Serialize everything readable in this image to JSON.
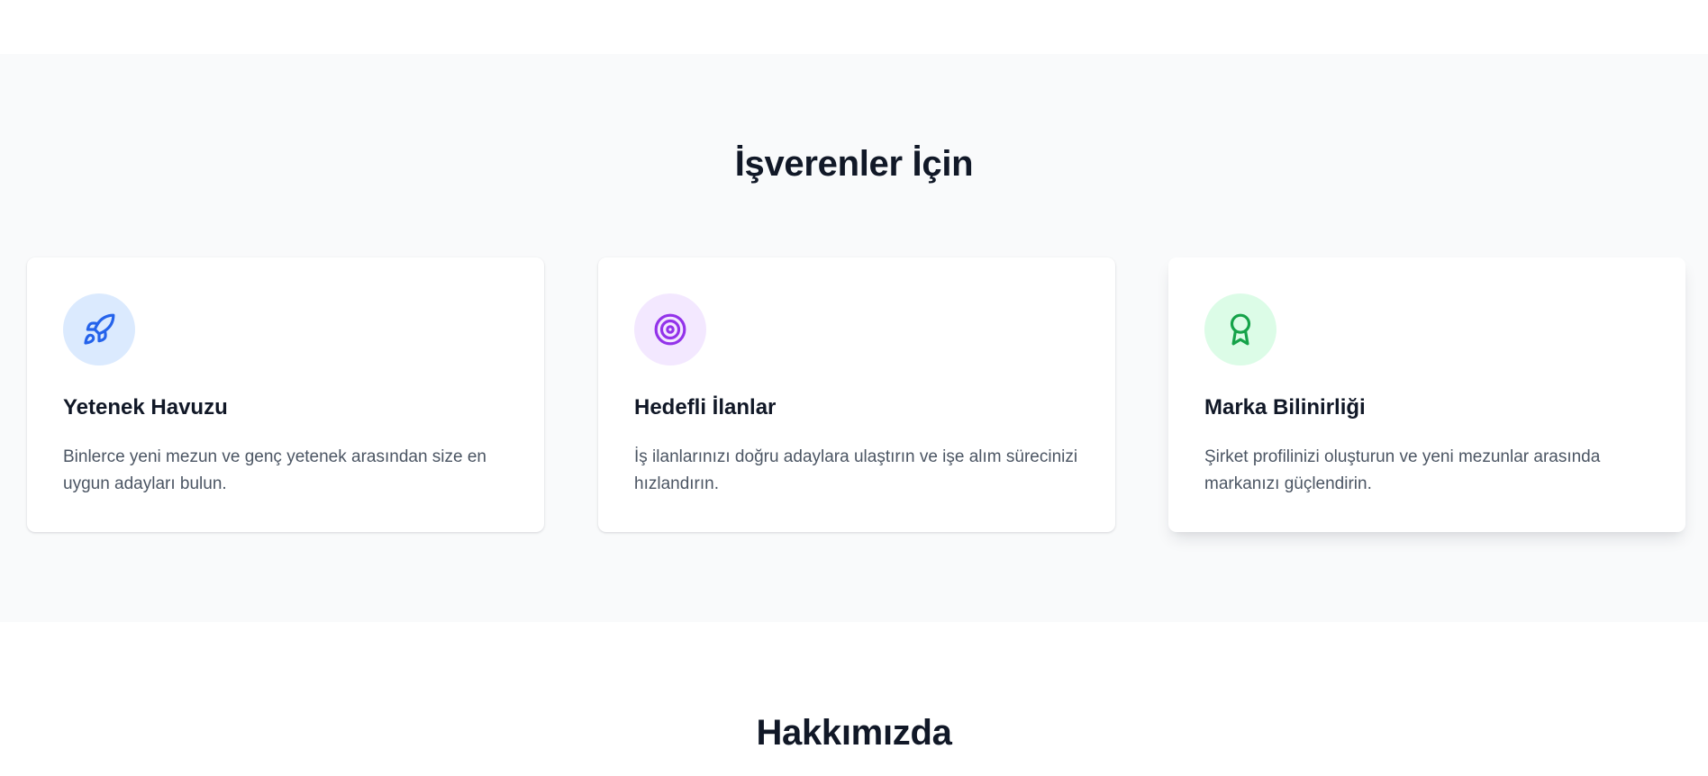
{
  "employers": {
    "title": "İşverenler İçin",
    "cards": [
      {
        "title": "Yetenek Havuzu",
        "description": "Binlerce yeni mezun ve genç yetenek arasından size en uygun adayları bulun.",
        "icon": "rocket-icon",
        "icon_color": "#2563eb",
        "icon_bg": "#dbeafe"
      },
      {
        "title": "Hedefli İlanlar",
        "description": "İş ilanlarınızı doğru adaylara ulaştırın ve işe alım sürecinizi hızlandırın.",
        "icon": "target-icon",
        "icon_color": "#9333ea",
        "icon_bg": "#f3e8ff"
      },
      {
        "title": "Marka Bilinirliği",
        "description": "Şirket profilinizi oluşturun ve yeni mezunlar arasında markanızı güçlendirin.",
        "icon": "award-icon",
        "icon_color": "#16a34a",
        "icon_bg": "#dcfce7"
      }
    ]
  },
  "about": {
    "title": "Hakkımızda"
  },
  "colors": {
    "section_bg": "#f9fafb",
    "heading": "#111827",
    "body_text": "#4b5563"
  }
}
